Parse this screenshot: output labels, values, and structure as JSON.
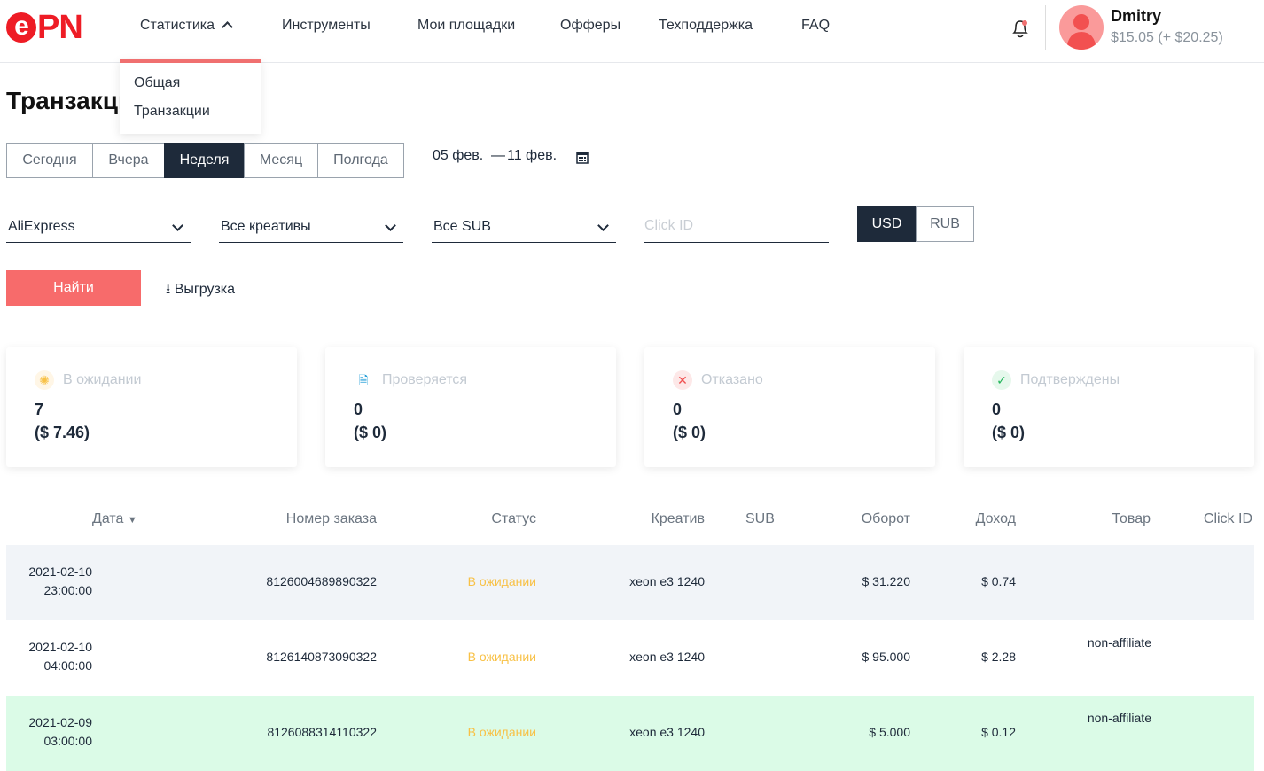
{
  "header": {
    "logo": "ePN",
    "logo_e": "e",
    "logo_rest": "PN",
    "nav": [
      {
        "label": "Статистика"
      },
      {
        "label": "Инструменты"
      },
      {
        "label": "Мои площадки"
      },
      {
        "label": "Офферы"
      },
      {
        "label": "Техподдержка"
      },
      {
        "label": "FAQ"
      }
    ],
    "dropdown": [
      "Общая",
      "Транзакции"
    ],
    "user": {
      "name": "Dmitry",
      "balance": "$15.05 (+ $20.25)"
    },
    "accent": "#ee1c25"
  },
  "page": {
    "title": "Транзакции"
  },
  "periods": [
    {
      "label": "Сегодня"
    },
    {
      "label": "Вчера"
    },
    {
      "label": "Неделя",
      "active": true
    },
    {
      "label": "Месяц"
    },
    {
      "label": "Полгода"
    }
  ],
  "date_range": {
    "from": "05 фев.",
    "sep": "—",
    "to": "11 фев."
  },
  "filters": {
    "offer": "AliExpress",
    "creative": "Все креативы",
    "sub": "Все SUB",
    "click_id_placeholder": "Click ID",
    "currency": [
      "USD",
      "RUB"
    ],
    "currency_active": "USD"
  },
  "actions": {
    "find": "Найти",
    "export": "Выгрузка"
  },
  "cards": [
    {
      "label": "В ожидании",
      "count": "7",
      "amount": "($ 7.46)",
      "icon": "hourglass-icon"
    },
    {
      "label": "Проверяется",
      "count": "0",
      "amount": "($ 0)",
      "icon": "document-search-icon"
    },
    {
      "label": "Отказано",
      "count": "0",
      "amount": "($ 0)",
      "icon": "x-icon"
    },
    {
      "label": "Подтверждены",
      "count": "0",
      "amount": "($ 0)",
      "icon": "check-icon"
    }
  ],
  "table": {
    "columns": [
      "Дата",
      "Номер заказа",
      "Статус",
      "Креатив",
      "SUB",
      "Оборот",
      "Доход",
      "Товар",
      "Click ID"
    ],
    "rows": [
      {
        "date": "2021-02-10",
        "time": "23:00:00",
        "order": "8126004689890322",
        "status": "В ожидании",
        "creative": "xeon e3 1240",
        "sub": "",
        "turnover": "$ 31.220",
        "income": "$ 0.74",
        "product": "",
        "click_id": ""
      },
      {
        "date": "2021-02-10",
        "time": "04:00:00",
        "order": "8126140873090322",
        "status": "В ожидании",
        "creative": "xeon e3 1240",
        "sub": "",
        "turnover": "$ 95.000",
        "income": "$ 2.28",
        "product": "non-affiliate",
        "click_id": ""
      },
      {
        "date": "2021-02-09",
        "time": "03:00:00",
        "order": "8126088314110322",
        "status": "В ожидании",
        "creative": "xeon e3 1240",
        "sub": "",
        "turnover": "$ 5.000",
        "income": "$ 0.12",
        "product": "non-affiliate",
        "click_id": ""
      }
    ]
  }
}
